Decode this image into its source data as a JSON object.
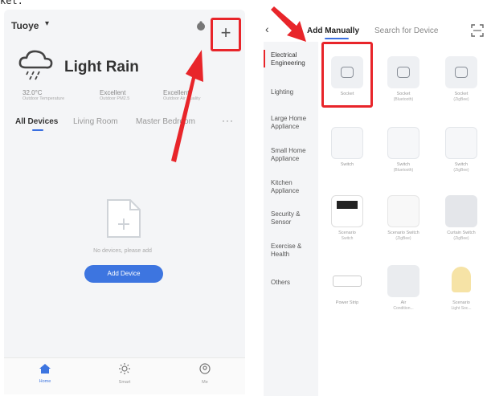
{
  "caption": "ket.",
  "left": {
    "home_name": "Tuoye",
    "weather": {
      "condition": "Light Rain",
      "stats": [
        {
          "value": "32.0°C",
          "label": "Outdoor Temperature"
        },
        {
          "value": "Excellent",
          "label": "Outdoor PM2.5"
        },
        {
          "value": "Excellent",
          "label": "Outdoor Air Quality"
        }
      ]
    },
    "tabs": [
      "All Devices",
      "Living Room",
      "Master Bedroom"
    ],
    "more": "···",
    "empty_text": "No devices, please add",
    "add_button": "Add Device",
    "nav": [
      "Home",
      "Smart",
      "Me"
    ]
  },
  "right": {
    "tabs": [
      "Add Manually",
      "Search for Device"
    ],
    "categories": [
      "Electrical Engineering",
      "Lighting",
      "Large Home Appliance",
      "Small Home Appliance",
      "Kitchen Appliance",
      "Security & Sensor",
      "Exercise & Health",
      "Others"
    ],
    "devices": [
      {
        "name": "Socket",
        "sub": ""
      },
      {
        "name": "Socket",
        "sub": "(Bluetooth)"
      },
      {
        "name": "Socket",
        "sub": "(ZigBee)"
      },
      {
        "name": "Switch",
        "sub": ""
      },
      {
        "name": "Switch",
        "sub": "(Bluetooth)"
      },
      {
        "name": "Switch",
        "sub": "(ZigBee)"
      },
      {
        "name": "Scenario",
        "sub": "Switch"
      },
      {
        "name": "Scenario Switch",
        "sub": "(ZigBee)"
      },
      {
        "name": "Curtain Switch",
        "sub": "(ZigBee)"
      },
      {
        "name": "Power Strip",
        "sub": ""
      },
      {
        "name": "Air",
        "sub": "Condition..."
      },
      {
        "name": "Scenario",
        "sub": "Light Soc..."
      }
    ]
  },
  "colors": {
    "accent": "#3d75e0",
    "highlight": "#e8252a"
  }
}
